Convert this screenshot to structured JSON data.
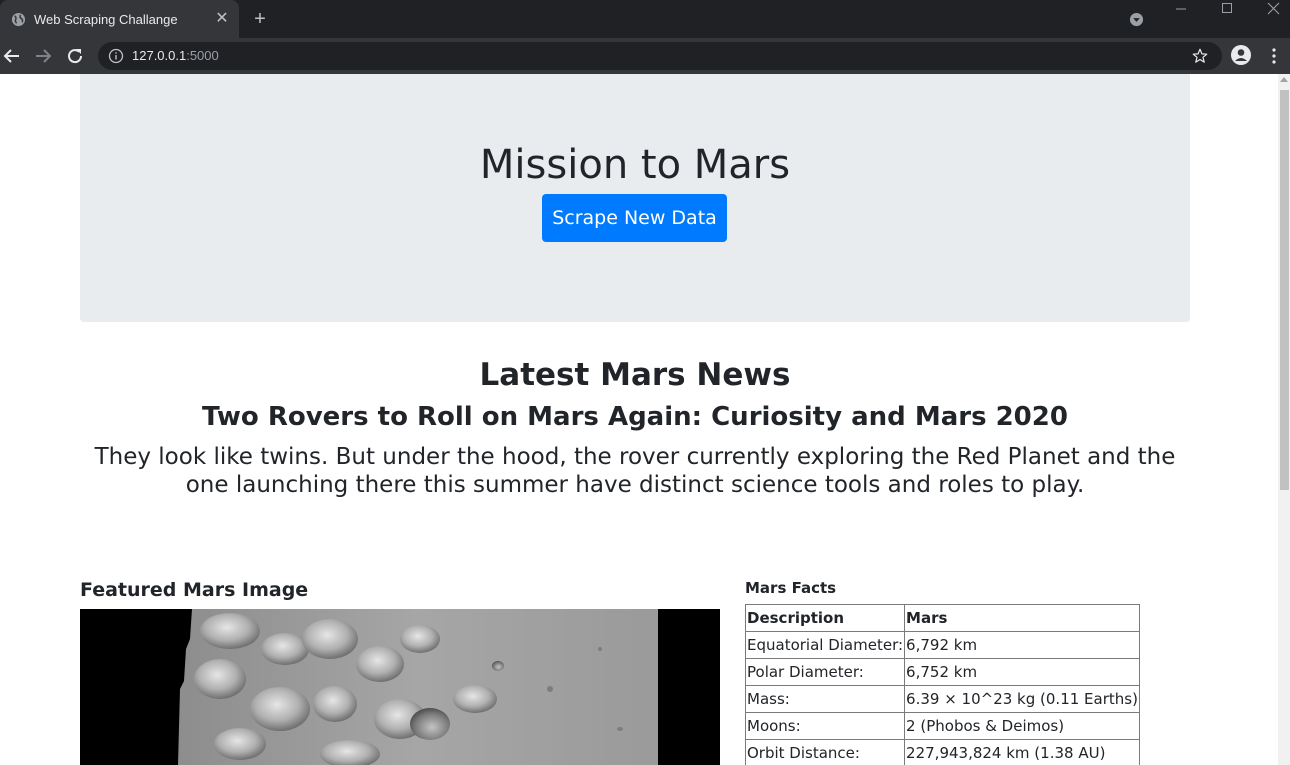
{
  "browser": {
    "tab_title": "Web Scraping Challange",
    "url_host": "127.0.0.1",
    "url_port": ":5000"
  },
  "jumbotron": {
    "title": "Mission to Mars",
    "button_label": "Scrape New Data"
  },
  "news": {
    "heading": "Latest Mars News",
    "title": "Two Rovers to Roll on Mars Again: Curiosity and Mars 2020",
    "teaser": "They look like twins. But under the hood, the rover currently exploring the Red Planet and the one launching there this summer have distinct science tools and roles to play."
  },
  "featured": {
    "heading": "Featured Mars Image"
  },
  "facts": {
    "heading": "Mars Facts",
    "headers": [
      "Description",
      "Mars"
    ],
    "rows": [
      [
        "Equatorial Diameter:",
        "6,792 km"
      ],
      [
        "Polar Diameter:",
        "6,752 km"
      ],
      [
        "Mass:",
        "6.39 × 10^23 kg (0.11 Earths)"
      ],
      [
        "Moons:",
        "2 (Phobos & Deimos)"
      ],
      [
        "Orbit Distance:",
        "227,943,824 km (1.38 AU)"
      ]
    ]
  },
  "colors": {
    "chrome_dark": "#202124",
    "chrome_tab": "#35363a",
    "jumbotron_bg": "#e9ecef",
    "primary_button": "#007bff",
    "text": "#212529"
  },
  "icons": {
    "favicon": "globe-icon",
    "back": "arrow-left-icon",
    "forward": "arrow-right-icon",
    "reload": "reload-icon",
    "info": "info-icon",
    "bookmark": "star-icon",
    "account": "account-icon",
    "menu": "kebab-menu-icon"
  }
}
